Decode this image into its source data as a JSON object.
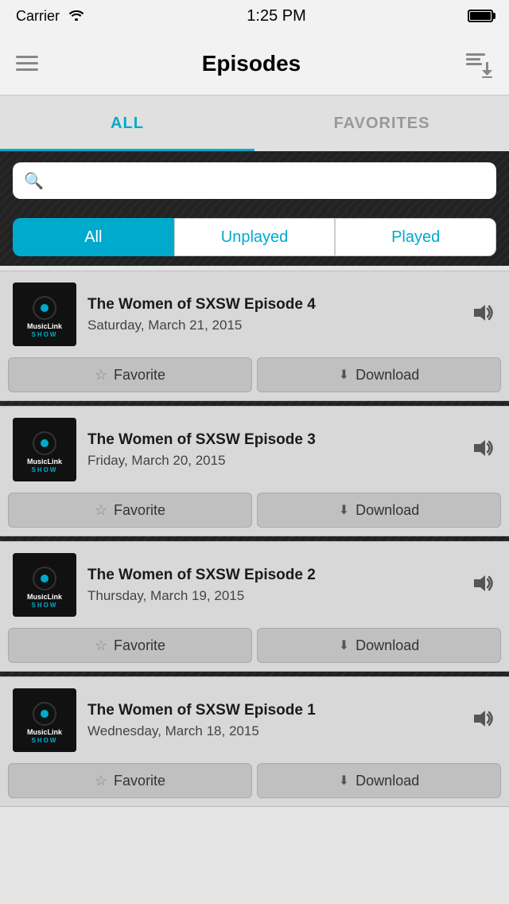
{
  "statusBar": {
    "carrier": "Carrier",
    "time": "1:25 PM"
  },
  "header": {
    "title": "Episodes",
    "downloadAllLabel": "download-all"
  },
  "tabs": [
    {
      "id": "all",
      "label": "ALL",
      "active": true
    },
    {
      "id": "favorites",
      "label": "FAVORITES",
      "active": false
    }
  ],
  "search": {
    "placeholder": ""
  },
  "filters": [
    {
      "id": "all",
      "label": "All",
      "active": true
    },
    {
      "id": "unplayed",
      "label": "Unplayed",
      "active": false
    },
    {
      "id": "played",
      "label": "Played",
      "active": false
    }
  ],
  "episodes": [
    {
      "title": "The Women of SXSW Episode 4",
      "date": "Saturday, March 21, 2015",
      "favoriteLabel": "Favorite",
      "downloadLabel": "Download"
    },
    {
      "title": "The Women of SXSW Episode 3",
      "date": "Friday, March 20, 2015",
      "favoriteLabel": "Favorite",
      "downloadLabel": "Download"
    },
    {
      "title": "The Women of SXSW Episode 2",
      "date": "Thursday, March 19, 2015",
      "favoriteLabel": "Favorite",
      "downloadLabel": "Download"
    },
    {
      "title": "The Women of SXSW Episode 1",
      "date": "Wednesday, March 18, 2015",
      "favoriteLabel": "Favorite",
      "downloadLabel": "Download"
    }
  ]
}
